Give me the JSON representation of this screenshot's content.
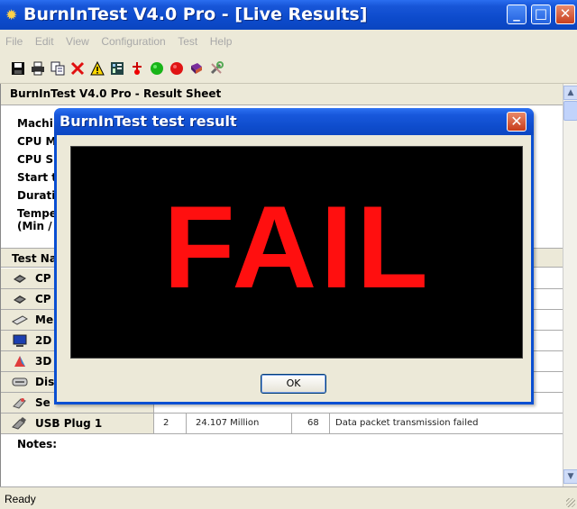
{
  "window": {
    "title": "BurnInTest V4.0 Pro - [Live Results]",
    "min_glyph": "_",
    "max_glyph": "□",
    "close_glyph": "✕"
  },
  "menu": [
    "File",
    "Edit",
    "View",
    "Configuration",
    "Test",
    "Help"
  ],
  "toolbar": {
    "icons": [
      "save-icon",
      "print-icon",
      "copy-icon",
      "delete-icon",
      "warning-icon",
      "chart-icon",
      "temperature-icon",
      "start-icon",
      "stop-icon",
      "help-book-icon",
      "tools-icon"
    ]
  },
  "sheet": {
    "header": "BurnInTest V4.0 Pro - Result Sheet",
    "info_labels": [
      "Machi",
      "CPU M",
      "CPU S",
      "Start t",
      "Durati",
      "Tempe",
      "(Min /"
    ],
    "test_header": "Test Na",
    "tests": [
      {
        "name": "CP",
        "icon": "cpu-icon"
      },
      {
        "name": "CP",
        "icon": "cpu-icon"
      },
      {
        "name": "Me",
        "icon": "memory-icon"
      },
      {
        "name": "2D",
        "icon": "monitor-icon"
      },
      {
        "name": "3D",
        "icon": "3d-icon"
      },
      {
        "name": "Dis",
        "icon": "disk-icon"
      },
      {
        "name": "Se",
        "icon": "serial-icon"
      },
      {
        "name": "USB Plug 1",
        "icon": "usb-icon",
        "cycles": "2",
        "operations": "24.107 Million",
        "errors": "68",
        "last_error": "Data packet transmission failed"
      }
    ],
    "notes_label": "Notes:"
  },
  "status": {
    "text": "Ready"
  },
  "dialog": {
    "title": "BurnInTest test result",
    "close_glyph": "✕",
    "result": "FAIL",
    "ok_label": "OK"
  }
}
